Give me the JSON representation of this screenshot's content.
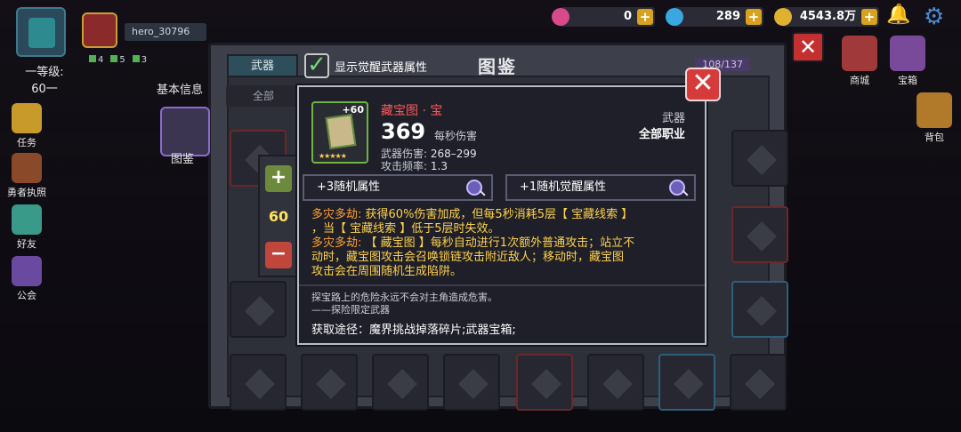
{
  "hud": {
    "level": "一等级: 60一",
    "hero_name": "hero_30796",
    "mini_stats": [
      "4",
      "5",
      "3"
    ],
    "gems_pink": "0",
    "gems_blue": "289",
    "gold": "4543.8万"
  },
  "left_menu": [
    {
      "label": "任务"
    },
    {
      "label": "勇者执照"
    },
    {
      "label": "好友"
    },
    {
      "label": "公会"
    }
  ],
  "right_menu": [
    {
      "label": "商城"
    },
    {
      "label": "宝箱"
    },
    {
      "label": "背包"
    }
  ],
  "codex": {
    "title": "图鉴",
    "tab": "武器",
    "count": "108/137",
    "awaken_toggle_label": "显示觉醒武器属性",
    "filters": [
      "全部",
      "全部",
      "全部",
      "全部"
    ],
    "side_labels": [
      "基本信息",
      "图鉴"
    ]
  },
  "level_stepper": {
    "value": "60"
  },
  "weapon": {
    "plus_level": "+60",
    "name": "藏宝图 · 宝",
    "dps": "369",
    "dps_label": "每秒伤害",
    "damage_label": "武器伤害:",
    "damage": "268–299",
    "attack_rate_label": "攻击频率:",
    "attack_rate": "1.3",
    "type": "武器",
    "class": "全部职业",
    "random_attr": "+3随机属性",
    "awaken_attr": "+1随机觉醒属性",
    "desc_1_tag": "多灾多劫:",
    "desc_1_lines": [
      "获得60%伤害加成，但每5秒消耗5层【 宝藏线索 】",
      "，当【 宝藏线索 】低于5层时失效。"
    ],
    "desc_2_tag": "多灾多劫:",
    "desc_2_lines": [
      "【 藏宝图 】每秒自动进行1次额外普通攻击；站立不",
      "动时，藏宝图攻击会召唤锁链攻击附近敌人；移动时，藏宝图",
      "攻击会在周围随机生成陷阱。"
    ],
    "lore": "探宝路上的危险永远不会对主角造成危害。",
    "lore_sub": "——探险限定武器",
    "source_label": "获取途径：",
    "source": "魔界挑战掉落碎片;武器宝箱;"
  },
  "colors": {
    "name_red": "#ff5a5a",
    "desc_yellow": "#ffd24a",
    "tag_orange": "#ffa02a",
    "close_red": "#d73a3a"
  }
}
